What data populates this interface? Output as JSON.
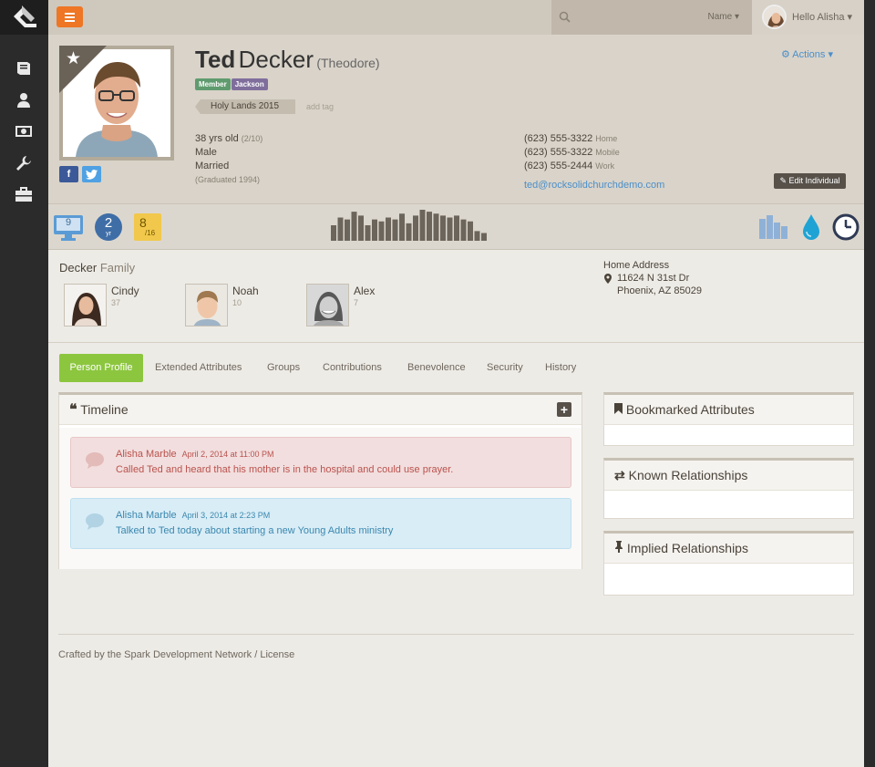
{
  "nav": {
    "items": [
      {
        "icon": "book-icon"
      },
      {
        "icon": "person-icon"
      },
      {
        "icon": "money-icon"
      },
      {
        "icon": "wrench-icon"
      },
      {
        "icon": "briefcase-icon"
      }
    ]
  },
  "topbar": {
    "search_filter": "Name ▾",
    "user_greeting": "Hello Alisha ▾"
  },
  "person": {
    "nick_name": "Ted",
    "last_name": "Decker",
    "full_name": "(Theodore)",
    "badges": [
      {
        "label": "Member",
        "color": "#5f9b6e"
      },
      {
        "label": "Jackson",
        "color": "#7f6e9c"
      }
    ],
    "tag": "Holy Lands 2015",
    "add_tag": "add tag",
    "age": "38 yrs old",
    "birth": "(2/10)",
    "gender": "Male",
    "marital": "Married",
    "graduated": "(Graduated 1994)",
    "phones": [
      {
        "number": "(623) 555-3322",
        "type": "Home"
      },
      {
        "number": "(623) 555-3322",
        "type": "Mobile"
      },
      {
        "number": "(623) 555-2444",
        "type": "Work"
      }
    ],
    "email": "ted@rocksolidchurchdemo.com",
    "actions_label": "⚙ Actions ▾",
    "edit_label": "✎ Edit Individual"
  },
  "badgebar": {
    "attendance": "9",
    "years": "2",
    "years_unit": "yr",
    "serving": "8",
    "serving_of": "/16",
    "attendance_bars": [
      16,
      24,
      22,
      30,
      26,
      16,
      22,
      20,
      24,
      22,
      28,
      18,
      26,
      32,
      30,
      28,
      26,
      24,
      26,
      22,
      20,
      10,
      8
    ]
  },
  "family": {
    "last_name": "Decker",
    "label": "Family",
    "members": [
      {
        "name": "Cindy",
        "age": "37"
      },
      {
        "name": "Noah",
        "age": "10"
      },
      {
        "name": "Alex",
        "age": "7"
      }
    ],
    "address_label": "Home Address",
    "street": "11624 N 31st Dr",
    "city": "Phoenix, AZ 85029"
  },
  "tabs": [
    "Person Profile",
    "Extended Attributes",
    "Groups",
    "Contributions",
    "Benevolence",
    "Security",
    "History"
  ],
  "timeline": {
    "title": "Timeline",
    "notes": [
      {
        "author": "Alisha Marble",
        "date": "April 2, 2014 at 11:00 PM",
        "text": "Called Ted and heard that his mother is in the hospital and could use prayer.",
        "color": "#b9524d",
        "bg": "#f2dede",
        "border": "#e8c6c6"
      },
      {
        "author": "Alisha Marble",
        "date": "April 3, 2014 at 2:23 PM",
        "text": "Talked to Ted today about starting a new Young Adults ministry",
        "color": "#3a87ad",
        "bg": "#d9edf7",
        "border": "#bfe0ef"
      }
    ]
  },
  "side": {
    "bookmarked": "Bookmarked Attributes",
    "known": "Known Relationships",
    "implied": "Implied Relationships"
  },
  "footer": "Crafted by the Spark Development Network / License"
}
